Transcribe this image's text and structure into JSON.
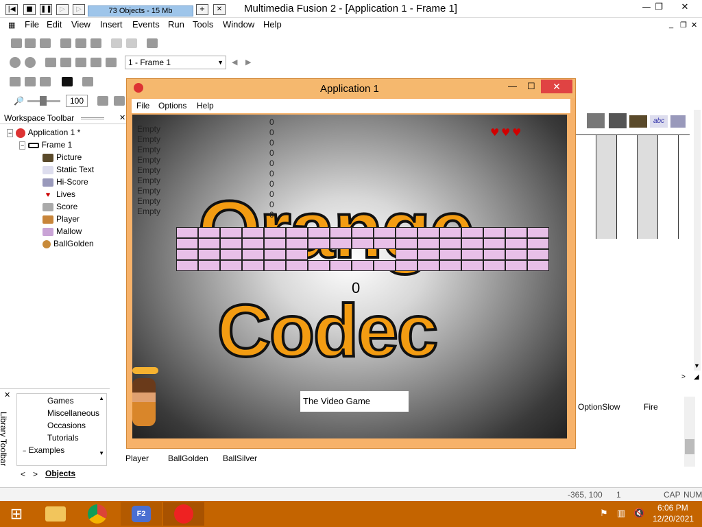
{
  "window": {
    "title": "Multimedia Fusion 2 - [Application 1 - Frame 1]",
    "object_count": "73 Objects - 15 Mb",
    "minimize": "—",
    "restore": "❐",
    "close": "✕"
  },
  "menu": {
    "items": [
      "File",
      "Edit",
      "View",
      "Insert",
      "Events",
      "Run",
      "Tools",
      "Window",
      "Help"
    ]
  },
  "toolbar": {
    "frame_select": "1 - Frame 1",
    "zoom": "100"
  },
  "workspace": {
    "title": "Workspace Toolbar",
    "app": "Application 1 *",
    "frame": "Frame 1",
    "objects": [
      "Picture",
      "Static Text",
      "Hi-Score",
      "Lives",
      "Score",
      "Player",
      "Mallow",
      "BallGolden"
    ]
  },
  "app_window": {
    "title": "Application 1",
    "menu": [
      "File",
      "Options",
      "Help"
    ],
    "hiscore_names": [
      "Empty",
      "Empty",
      "Empty",
      "Empty",
      "Empty",
      "Empty",
      "Empty",
      "Empty",
      "Empty"
    ],
    "hiscore_values": [
      "0",
      "0",
      "0",
      "0",
      "0",
      "0",
      "0",
      "0",
      "0",
      "0"
    ],
    "word1": "Orange",
    "word2": "Codec",
    "score": "0",
    "subtitle": "The Video Game",
    "lives": 3
  },
  "library": {
    "title": "Library Toolbar",
    "items": [
      "Games",
      "Miscellaneous",
      "Occasions",
      "Tutorials"
    ],
    "examples": "Examples",
    "tab": "Objects"
  },
  "frame_objects": [
    "Player",
    "BallGolden",
    "BallSilver"
  ],
  "right_objects": [
    "OptionSlow",
    "Fire"
  ],
  "status": {
    "coords": "-365, 100",
    "layer": "1",
    "cap": "CAP",
    "num": "NUM"
  },
  "clock": {
    "time": "6:06 PM",
    "date": "12/20/2021"
  },
  "colors": {
    "accent": "#f39c12",
    "brick": "#e8bfe8",
    "taskbar": "#c46400",
    "app_frame": "#f7b26a"
  }
}
